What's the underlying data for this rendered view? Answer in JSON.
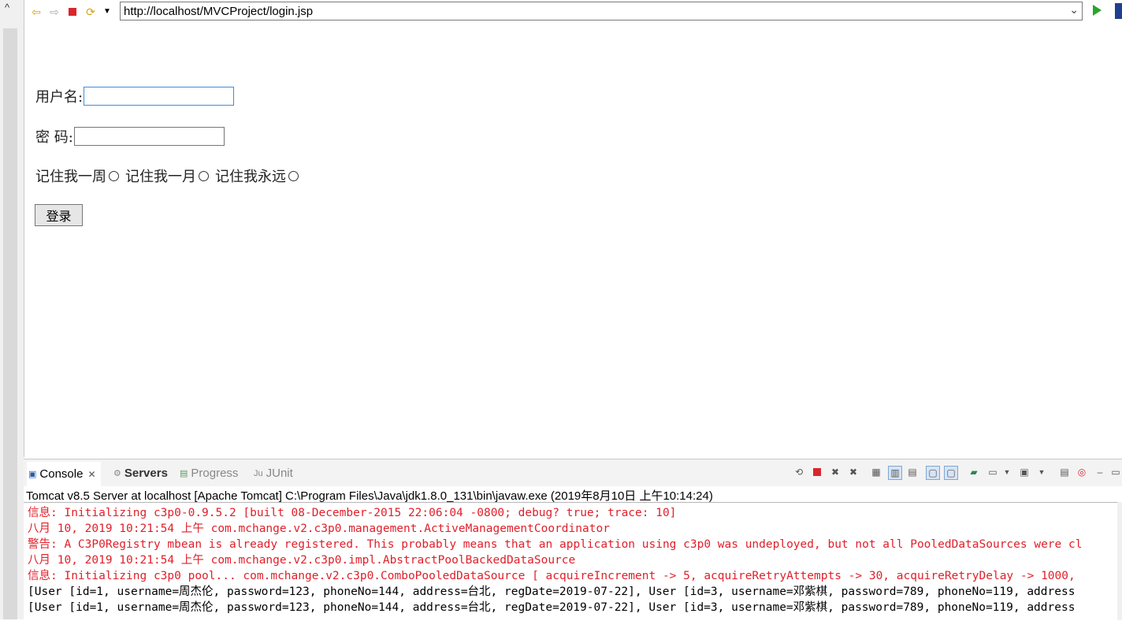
{
  "browser": {
    "url": "http://localhost/MVCProject/login.jsp"
  },
  "form": {
    "username_label": "用户名:",
    "password_label": "密 码:",
    "remember_week": "记住我一周",
    "remember_month": "记住我一月",
    "remember_forever": "记住我永远",
    "login_button": "登录"
  },
  "panel": {
    "tabs": [
      {
        "label": "Console"
      },
      {
        "label": "Servers"
      },
      {
        "label": "Progress"
      },
      {
        "label": "JUnit"
      }
    ],
    "console_header": "Tomcat v8.5 Server at localhost [Apache Tomcat] C:\\Program Files\\Java\\jdk1.8.0_131\\bin\\javaw.exe (2019年8月10日 上午10:14:24)",
    "lines": [
      "信息: Initializing c3p0-0.9.5.2 [built 08-December-2015 22:06:04 -0800; debug? true; trace: 10]",
      "八月 10, 2019 10:21:54 上午 com.mchange.v2.c3p0.management.ActiveManagementCoordinator",
      "警告: A C3P0Registry mbean is already registered. This probably means that an application using c3p0 was undeployed, but not all PooledDataSources were cl",
      "八月 10, 2019 10:21:54 上午 com.mchange.v2.c3p0.impl.AbstractPoolBackedDataSource",
      "信息: Initializing c3p0 pool... com.mchange.v2.c3p0.ComboPooledDataSource [ acquireIncrement -> 5, acquireRetryAttempts -> 30, acquireRetryDelay -> 1000,",
      "[User [id=1, username=周杰伦, password=123, phoneNo=144, address=台北, regDate=2019-07-22], User [id=3, username=邓紫棋, password=789, phoneNo=119, address",
      "[User [id=1, username=周杰伦, password=123, phoneNo=144, address=台北, regDate=2019-07-22], User [id=3, username=邓紫棋, password=789, phoneNo=119, address"
    ]
  },
  "icons": {
    "back": "back-arrow-icon",
    "forward": "forward-arrow-icon",
    "stop": "stop-icon",
    "refresh": "refresh-icon",
    "go": "go-icon"
  },
  "colors": {
    "console_error": "#e0202a",
    "console_normal": "#000000",
    "input_focus": "#3b8ede"
  }
}
